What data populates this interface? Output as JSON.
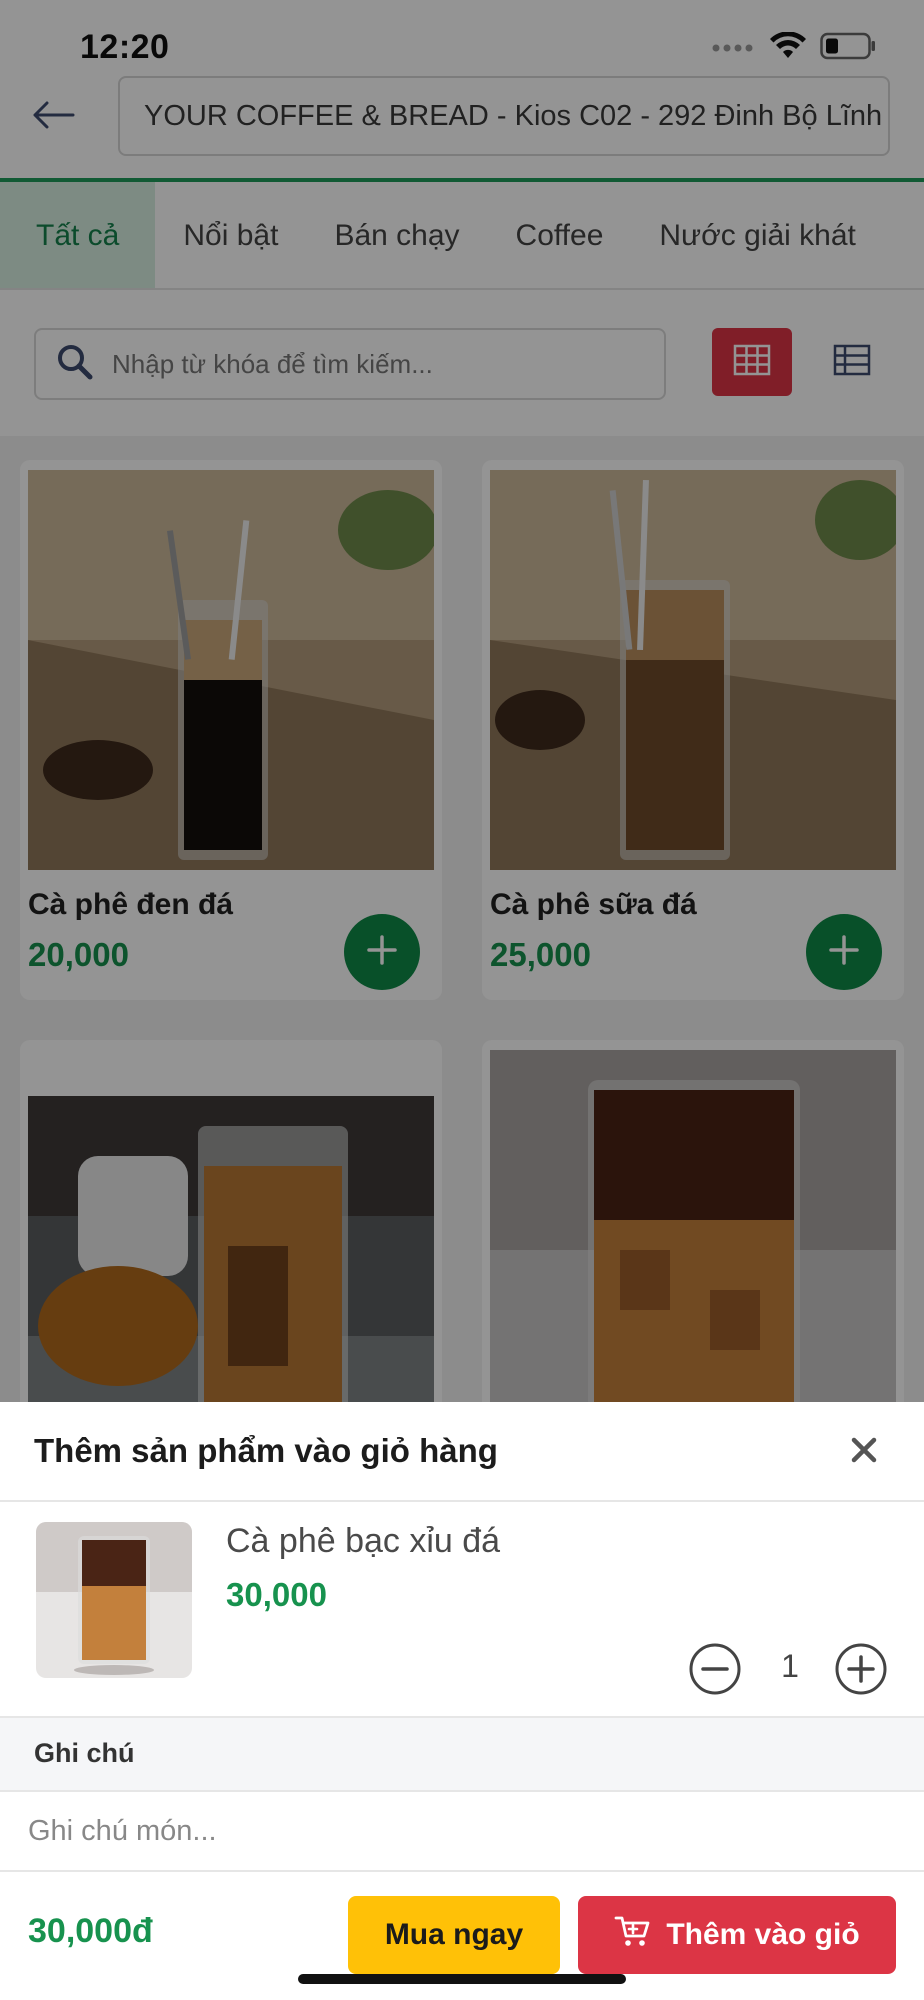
{
  "status_bar": {
    "time": "12:20"
  },
  "header": {
    "store_name": "YOUR COFFEE & BREAD - Kios C02 - 292 Đinh Bộ Lĩnh"
  },
  "tabs": [
    {
      "label": "Tất cả",
      "active": true
    },
    {
      "label": "Nổi bật",
      "active": false
    },
    {
      "label": "Bán chạy",
      "active": false
    },
    {
      "label": "Coffee",
      "active": false
    },
    {
      "label": "Nước giải khát",
      "active": false
    }
  ],
  "search": {
    "placeholder": "Nhập từ khóa để tìm kiếm..."
  },
  "products": [
    {
      "name": "Cà phê đen đá",
      "price": "20,000"
    },
    {
      "name": "Cà phê sữa đá",
      "price": "25,000"
    },
    {
      "name": "",
      "price": ""
    },
    {
      "name": "",
      "price": ""
    }
  ],
  "sheet": {
    "title": "Thêm sản phẩm vào giỏ hàng",
    "product_name": "Cà phê bạc xỉu đá",
    "product_price": "30,000",
    "quantity": "1",
    "note_label": "Ghi chú",
    "note_placeholder": "Ghi chú món...",
    "total": "30,000đ",
    "buy_now_label": "Mua ngay",
    "add_to_cart_label": "Thêm vào giỏ"
  },
  "colors": {
    "brand_green": "#17924e",
    "accent_red": "#dc3545",
    "accent_yellow": "#ffc107"
  }
}
